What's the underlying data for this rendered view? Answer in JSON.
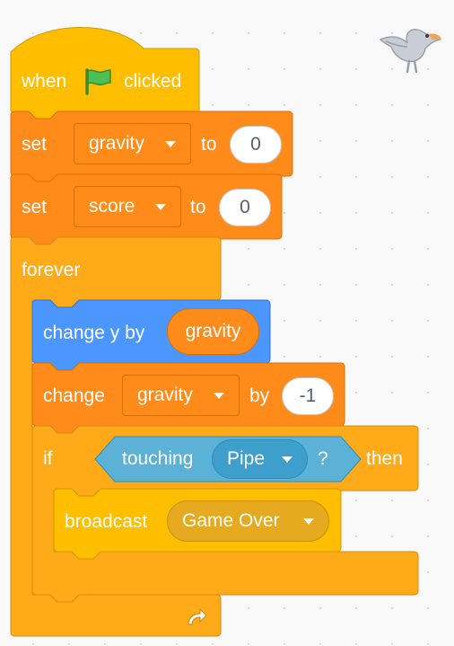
{
  "workspace": {
    "background_color": "#f9f9f9",
    "sprite_icon": "bird-sprite-icon"
  },
  "script": {
    "hat": {
      "prefix": "when",
      "icon": "green-flag-icon",
      "suffix": "clicked",
      "color": "#ffbf00"
    },
    "set_gravity": {
      "verb": "set",
      "variable": "gravity",
      "to_label": "to",
      "value": "0",
      "color": "#ff8c1a"
    },
    "set_score": {
      "verb": "set",
      "variable": "score",
      "to_label": "to",
      "value": "0",
      "color": "#ff8c1a"
    },
    "forever": {
      "label": "forever",
      "loop_icon": "loop-arrow-icon",
      "color": "#ffab19"
    },
    "change_y": {
      "label": "change y by",
      "reporter": "gravity",
      "color": "#4c97ff"
    },
    "change_gravity": {
      "verb": "change",
      "variable": "gravity",
      "by_label": "by",
      "value": "-1"
    },
    "if_block": {
      "if_label": "if",
      "then_label": "then",
      "condition": {
        "label": "touching",
        "object": "Pipe",
        "question": "?",
        "color": "#5cb1d6"
      }
    },
    "broadcast": {
      "label": "broadcast",
      "message": "Game Over",
      "color": "#ffbf00"
    }
  }
}
